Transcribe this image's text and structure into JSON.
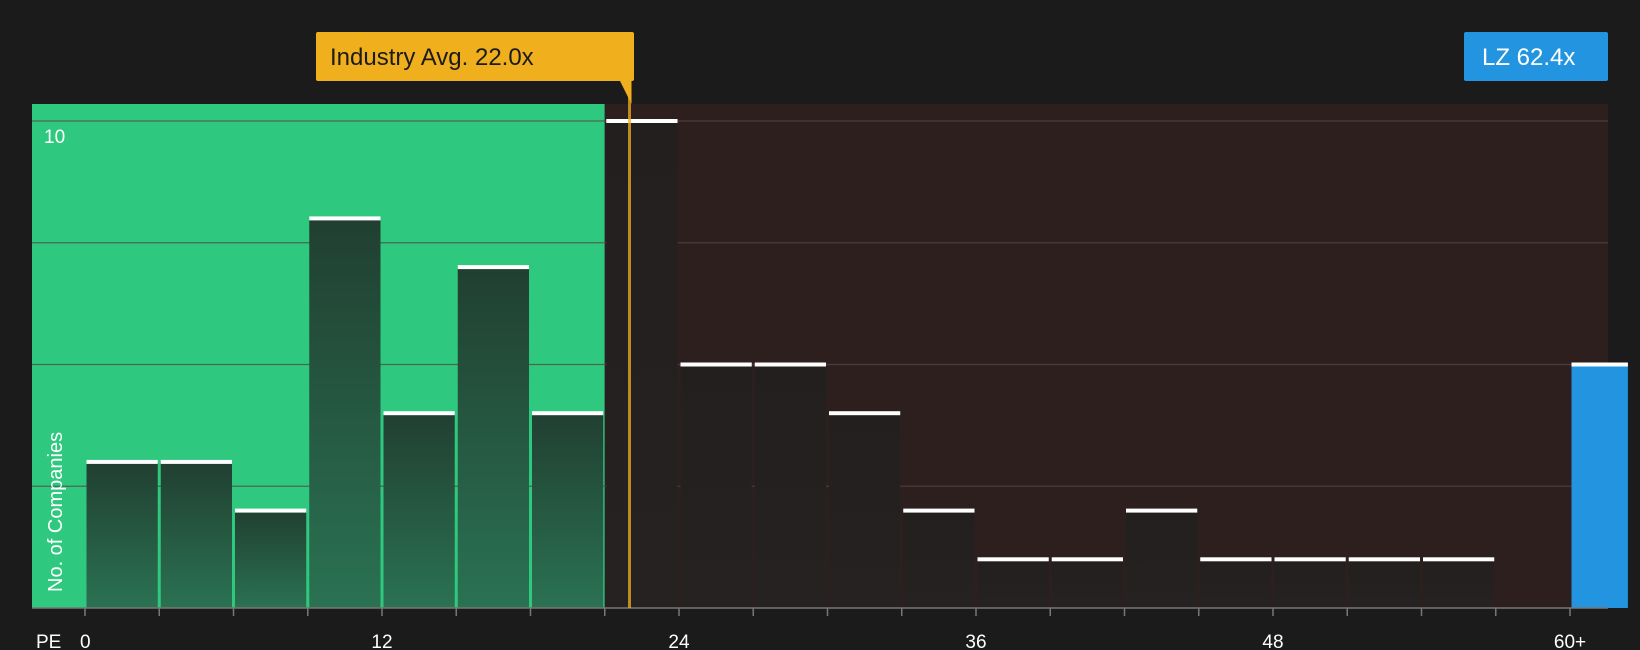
{
  "chart_data": {
    "type": "bar",
    "x_axis_label": "PE",
    "y_axis_label": "No. of Companies",
    "xlim": [
      0,
      62.4
    ],
    "ylim": [
      0,
      10.5
    ],
    "x_ticks": [
      0,
      12,
      24,
      36,
      48,
      60
    ],
    "x_tick_labels": [
      "0",
      "12",
      "24",
      "36",
      "48",
      "60+"
    ],
    "y_ticks_labeled": [
      10
    ],
    "y_gridlines": [
      2.5,
      5,
      7.5,
      10
    ],
    "bin_width": 3,
    "bins": [
      {
        "start": 0,
        "end": 3,
        "count": 3
      },
      {
        "start": 3,
        "end": 6,
        "count": 3
      },
      {
        "start": 6,
        "end": 9,
        "count": 2
      },
      {
        "start": 9,
        "end": 12,
        "count": 8
      },
      {
        "start": 12,
        "end": 15,
        "count": 4
      },
      {
        "start": 15,
        "end": 18,
        "count": 7
      },
      {
        "start": 18,
        "end": 21,
        "count": 4
      },
      {
        "start": 21,
        "end": 24,
        "count": 10
      },
      {
        "start": 24,
        "end": 27,
        "count": 5
      },
      {
        "start": 27,
        "end": 30,
        "count": 5
      },
      {
        "start": 30,
        "end": 33,
        "count": 4
      },
      {
        "start": 33,
        "end": 36,
        "count": 2
      },
      {
        "start": 36,
        "end": 39,
        "count": 1
      },
      {
        "start": 39,
        "end": 42,
        "count": 1
      },
      {
        "start": 42,
        "end": 45,
        "count": 2
      },
      {
        "start": 45,
        "end": 48,
        "count": 1
      },
      {
        "start": 48,
        "end": 51,
        "count": 1
      },
      {
        "start": 51,
        "end": 54,
        "count": 1
      },
      {
        "start": 54,
        "end": 57,
        "count": 1
      },
      {
        "start": 60,
        "end": 62.4,
        "count": 5,
        "highlight": true
      }
    ],
    "industry_avg": {
      "value": 22.0,
      "label": "Industry Avg. 22.0x"
    },
    "company": {
      "ticker": "LZ",
      "value": 62.4,
      "label": "LZ 62.4x"
    },
    "colors": {
      "background": "#1b1b1b",
      "undervalued_region": "#2ec97e",
      "overvalued_region": "#2e1f1f",
      "bar_dark": "#1e3f30",
      "bar_over": "#252020",
      "bar_top": "#ffffff",
      "industry_avg": "#f0b01e",
      "company": "#2394e0",
      "gridline": "#5a4444",
      "axis": "#777777"
    }
  }
}
